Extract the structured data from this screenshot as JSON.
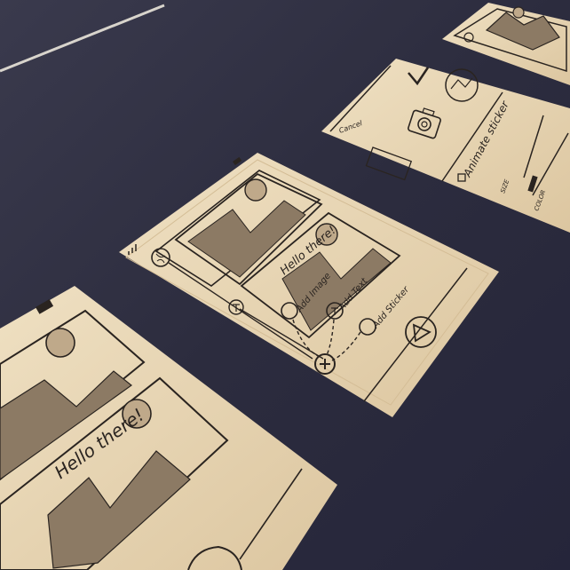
{
  "colors": {
    "table": "#2c2c3e",
    "paper": "#e9d8b8",
    "paper_shade": "#d7c09a",
    "ink": "#2a2420",
    "sketch_fill": "#8c7a64"
  },
  "sketch_main": {
    "bubble_text": "Hello there!",
    "menu_add_image": "Add Image",
    "menu_add_text": "Add Text",
    "menu_add_sticker": "Add Sticker"
  },
  "sketch_left": {
    "bubble_text": "Hello there!"
  },
  "sketch_settings": {
    "title": "Cancel",
    "option_animate": "Animate sticker",
    "label_size": "SIZE",
    "label_color": "COLOR"
  },
  "icons": [
    "signal-icon",
    "battery-icon",
    "globe-icon",
    "text-tool-icon",
    "image-icon",
    "sticker-icon",
    "plus-icon",
    "play-icon",
    "checkmark-icon",
    "camera-icon"
  ]
}
